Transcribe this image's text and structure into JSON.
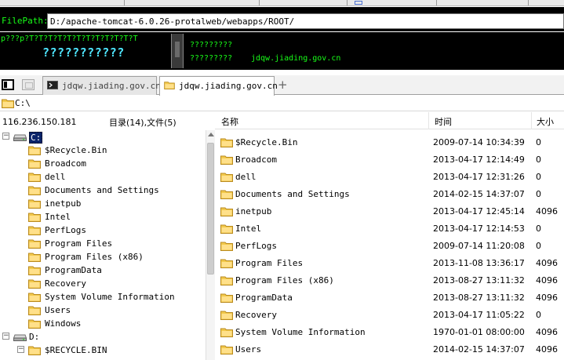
{
  "filepath": {
    "label": "FilePath:",
    "value": "D:/apache-tomcat-6.0.26-protalweb/webapps/ROOT/"
  },
  "info_panel": {
    "left_line1": "p???p?T?T?T?T?T?T?T?T?T?T?T?T",
    "left_line2": "???????????",
    "right_line1": "?????????",
    "right_line2": "?????????",
    "right_domain": "jdqw.jiading.gov.cn"
  },
  "tabs": [
    {
      "label": "jdqw.jiading.gov.cn",
      "icon": "terminal-icon",
      "active": false
    },
    {
      "label": "jdqw.jiading.gov.cn",
      "icon": "folder-icon",
      "active": true
    }
  ],
  "tab_add": "+",
  "path": {
    "value": "C:\\"
  },
  "status": {
    "ip": "116.236.150.181",
    "counts": "目录(14),文件(5)"
  },
  "columns": {
    "name": "名称",
    "time": "时间",
    "size": "大小"
  },
  "tree": {
    "drive_c": {
      "label": "C:",
      "expander": "−"
    },
    "c_children": [
      "$Recycle.Bin",
      "Broadcom",
      "dell",
      "Documents and Settings",
      "inetpub",
      "Intel",
      "PerfLogs",
      "Program Files",
      "Program Files (x86)",
      "ProgramData",
      "Recovery",
      "System Volume Information",
      "Users",
      "Windows"
    ],
    "drive_d": {
      "label": "D:",
      "expander": "−"
    },
    "d_children": [
      {
        "label": "$RECYCLE.BIN",
        "expander": "−"
      }
    ]
  },
  "files": [
    {
      "name": "$Recycle.Bin",
      "time": "2009-07-14 10:34:39",
      "size": "0"
    },
    {
      "name": "Broadcom",
      "time": "2013-04-17 12:14:49",
      "size": "0"
    },
    {
      "name": "dell",
      "time": "2013-04-17 12:31:26",
      "size": "0"
    },
    {
      "name": "Documents and Settings",
      "time": "2014-02-15 14:37:07",
      "size": "0"
    },
    {
      "name": "inetpub",
      "time": "2013-04-17 12:45:14",
      "size": "4096"
    },
    {
      "name": "Intel",
      "time": "2013-04-17 12:14:53",
      "size": "0"
    },
    {
      "name": "PerfLogs",
      "time": "2009-07-14 11:20:08",
      "size": "0"
    },
    {
      "name": "Program Files",
      "time": "2013-11-08 13:36:17",
      "size": "4096"
    },
    {
      "name": "Program Files (x86)",
      "time": "2013-08-27 13:11:32",
      "size": "4096"
    },
    {
      "name": "ProgramData",
      "time": "2013-08-27 13:11:32",
      "size": "4096"
    },
    {
      "name": "Recovery",
      "time": "2013-04-17 11:05:22",
      "size": "0"
    },
    {
      "name": "System Volume Information",
      "time": "1970-01-01 08:00:00",
      "size": "4096"
    },
    {
      "name": "Users",
      "time": "2014-02-15 14:37:07",
      "size": "4096"
    }
  ],
  "colors": {
    "terminal_green": "#18ff18",
    "banner_cyan": "#4fe6ff",
    "selection": "#0a246a",
    "folder_fill": "#f2c94c",
    "folder_edge": "#b98a1e"
  }
}
